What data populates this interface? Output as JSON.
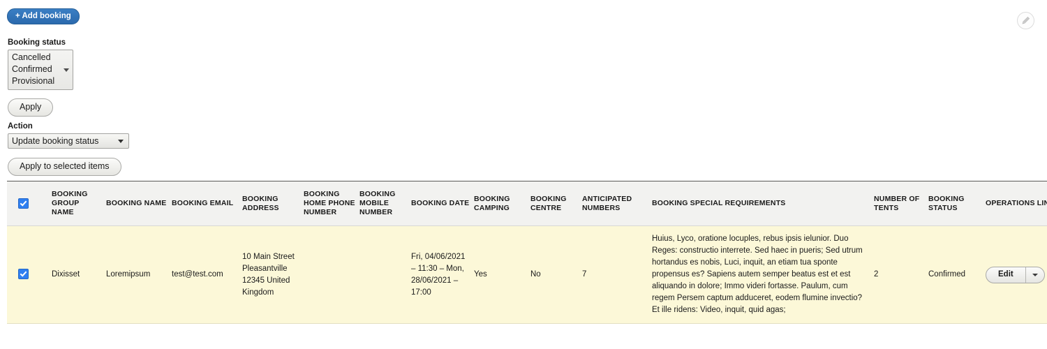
{
  "toolbar": {
    "add_booking_label": "+ Add booking",
    "edit_page_icon": "pencil-icon"
  },
  "filters": {
    "booking_status_label": "Booking status",
    "booking_status_options": [
      "Cancelled",
      "Confirmed",
      "Provisional"
    ],
    "apply_label": "Apply"
  },
  "actions": {
    "action_label": "Action",
    "action_selected": "Update booking status",
    "apply_to_selected_label": "Apply to selected items"
  },
  "table": {
    "select_all_checked": true,
    "columns": [
      "",
      "Booking group name",
      "Booking name",
      "Booking email",
      "Booking address",
      "Booking home phone number",
      "Booking mobile number",
      "Booking date",
      "Booking camping",
      "Booking centre",
      "Anticipated numbers",
      "Booking special requirements",
      "Number of tents",
      "Booking status",
      "Operations links"
    ],
    "rows": [
      {
        "selected": true,
        "group_name": "Dixisset",
        "name": "Loremipsum",
        "email": "test@test.com",
        "address": "10 Main Street Pleasantville 12345 United Kingdom",
        "home_phone": "",
        "mobile": "",
        "date": "Fri, 04/06/2021 – 11:30 – Mon, 28/06/2021 – 17:00",
        "camping": "Yes",
        "centre": "No",
        "anticipated_numbers": "7",
        "special_requirements": "Huius, Lyco, oratione locuples, rebus ipsis ielunior. Duo Reges: constructio interrete. Sed haec in pueris; Sed utrum hortandus es nobis, Luci, inquit, an etiam tua sponte propensus es? Sapiens autem semper beatus est et est aliquando in dolore; Immo videri fortasse. Paulum, cum regem Persem captum adduceret, eodem flumine invectio? Et ille ridens: Video, inquit, quid agas;",
        "number_of_tents": "2",
        "status": "Confirmed",
        "edit_label": "Edit"
      }
    ]
  },
  "colors": {
    "accent_blue": "#2f72b8",
    "row_highlight": "#fcf8d8",
    "header_bg": "#f2f2f0"
  }
}
